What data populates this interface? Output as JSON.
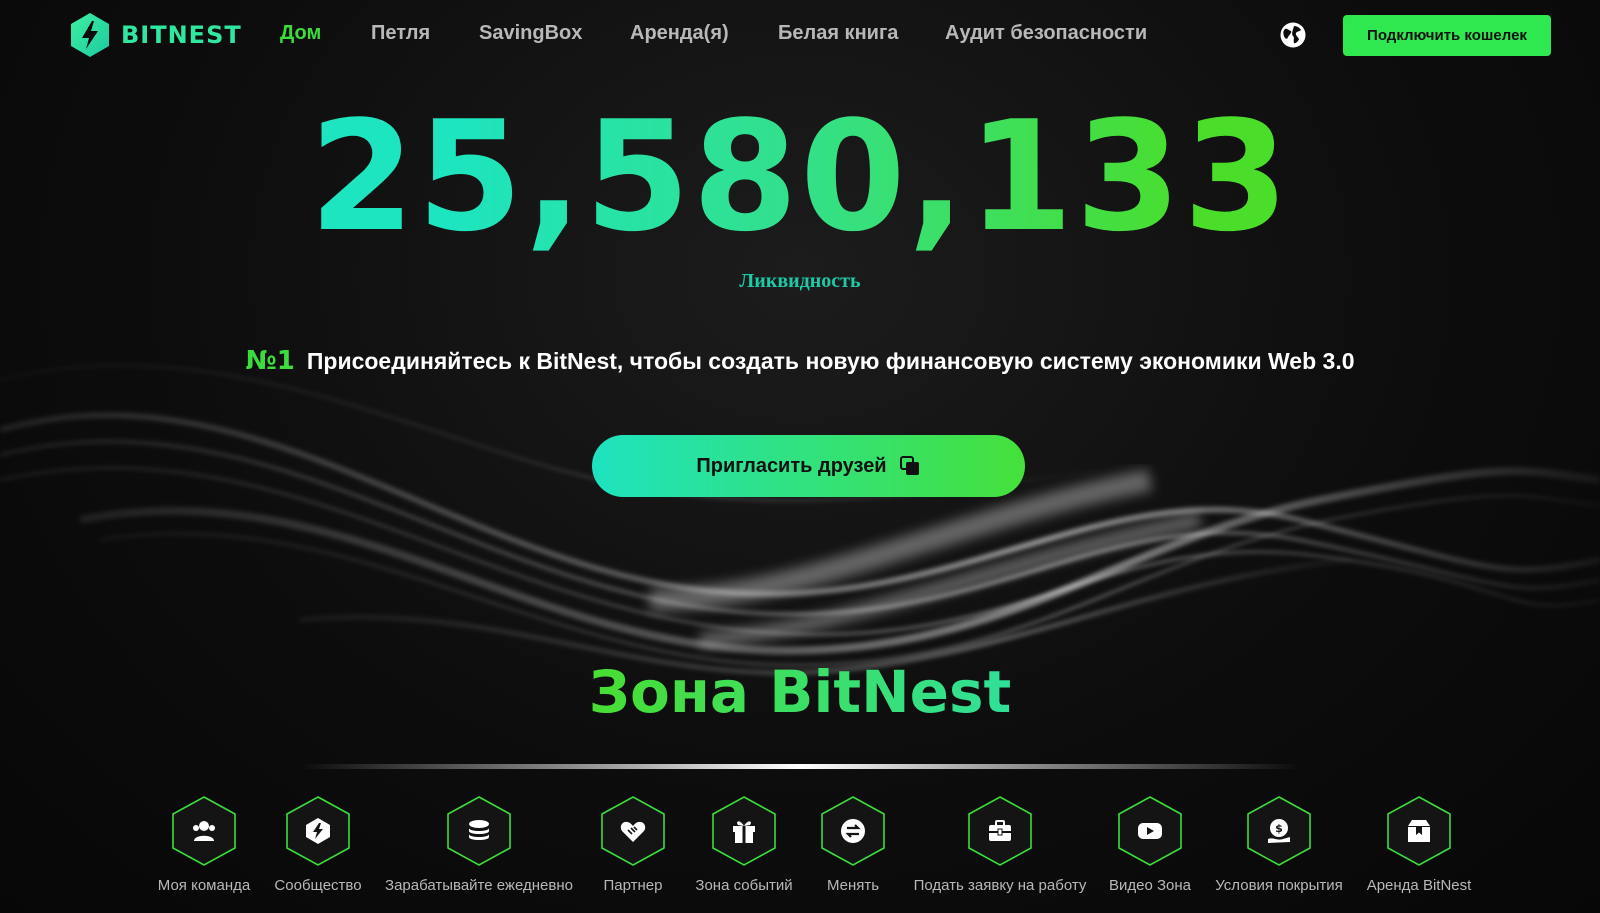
{
  "header": {
    "logo_text": "BITNEST",
    "nav": [
      {
        "label": "Дом",
        "active": true
      },
      {
        "label": "Петля",
        "active": false
      },
      {
        "label": "SavingBox",
        "active": false
      },
      {
        "label": "Аренда(я)",
        "active": false
      },
      {
        "label": "Белая книга",
        "active": false
      },
      {
        "label": "Аудит безопасности",
        "active": false
      }
    ],
    "language_icon": "globe-icon",
    "connect_label": "Подключить кошелек"
  },
  "hero": {
    "liquidity_value": "25,580,133",
    "liquidity_label": "Ликвидность",
    "rank_badge": "№1",
    "tagline": "Присоединяйтесь к BitNest, чтобы создать новую финансовую систему экономики Web 3.0",
    "invite_label": "Пригласить друзей",
    "invite_icon": "copy-icon"
  },
  "zone": {
    "title": "Зона BitNest",
    "items": [
      {
        "label": "Моя команда",
        "icon": "team-icon"
      },
      {
        "label": "Сообщество",
        "icon": "community-icon"
      },
      {
        "label": "Зарабатывайте ежедневно",
        "icon": "coins-icon"
      },
      {
        "label": "Партнер",
        "icon": "handshake-icon"
      },
      {
        "label": "Зона событий",
        "icon": "gift-icon"
      },
      {
        "label": "Менять",
        "icon": "swap-icon"
      },
      {
        "label": "Подать заявку на работу",
        "icon": "briefcase-icon"
      },
      {
        "label": "Видео Зона",
        "icon": "video-icon"
      },
      {
        "label": "Условия покрытия",
        "icon": "coverage-icon"
      },
      {
        "label": "Аренда BitNest",
        "icon": "rent-icon"
      }
    ]
  },
  "colors": {
    "accent_green": "#3ddc3d",
    "accent_teal": "#1ee3c0",
    "background": "#0b0b0b"
  }
}
